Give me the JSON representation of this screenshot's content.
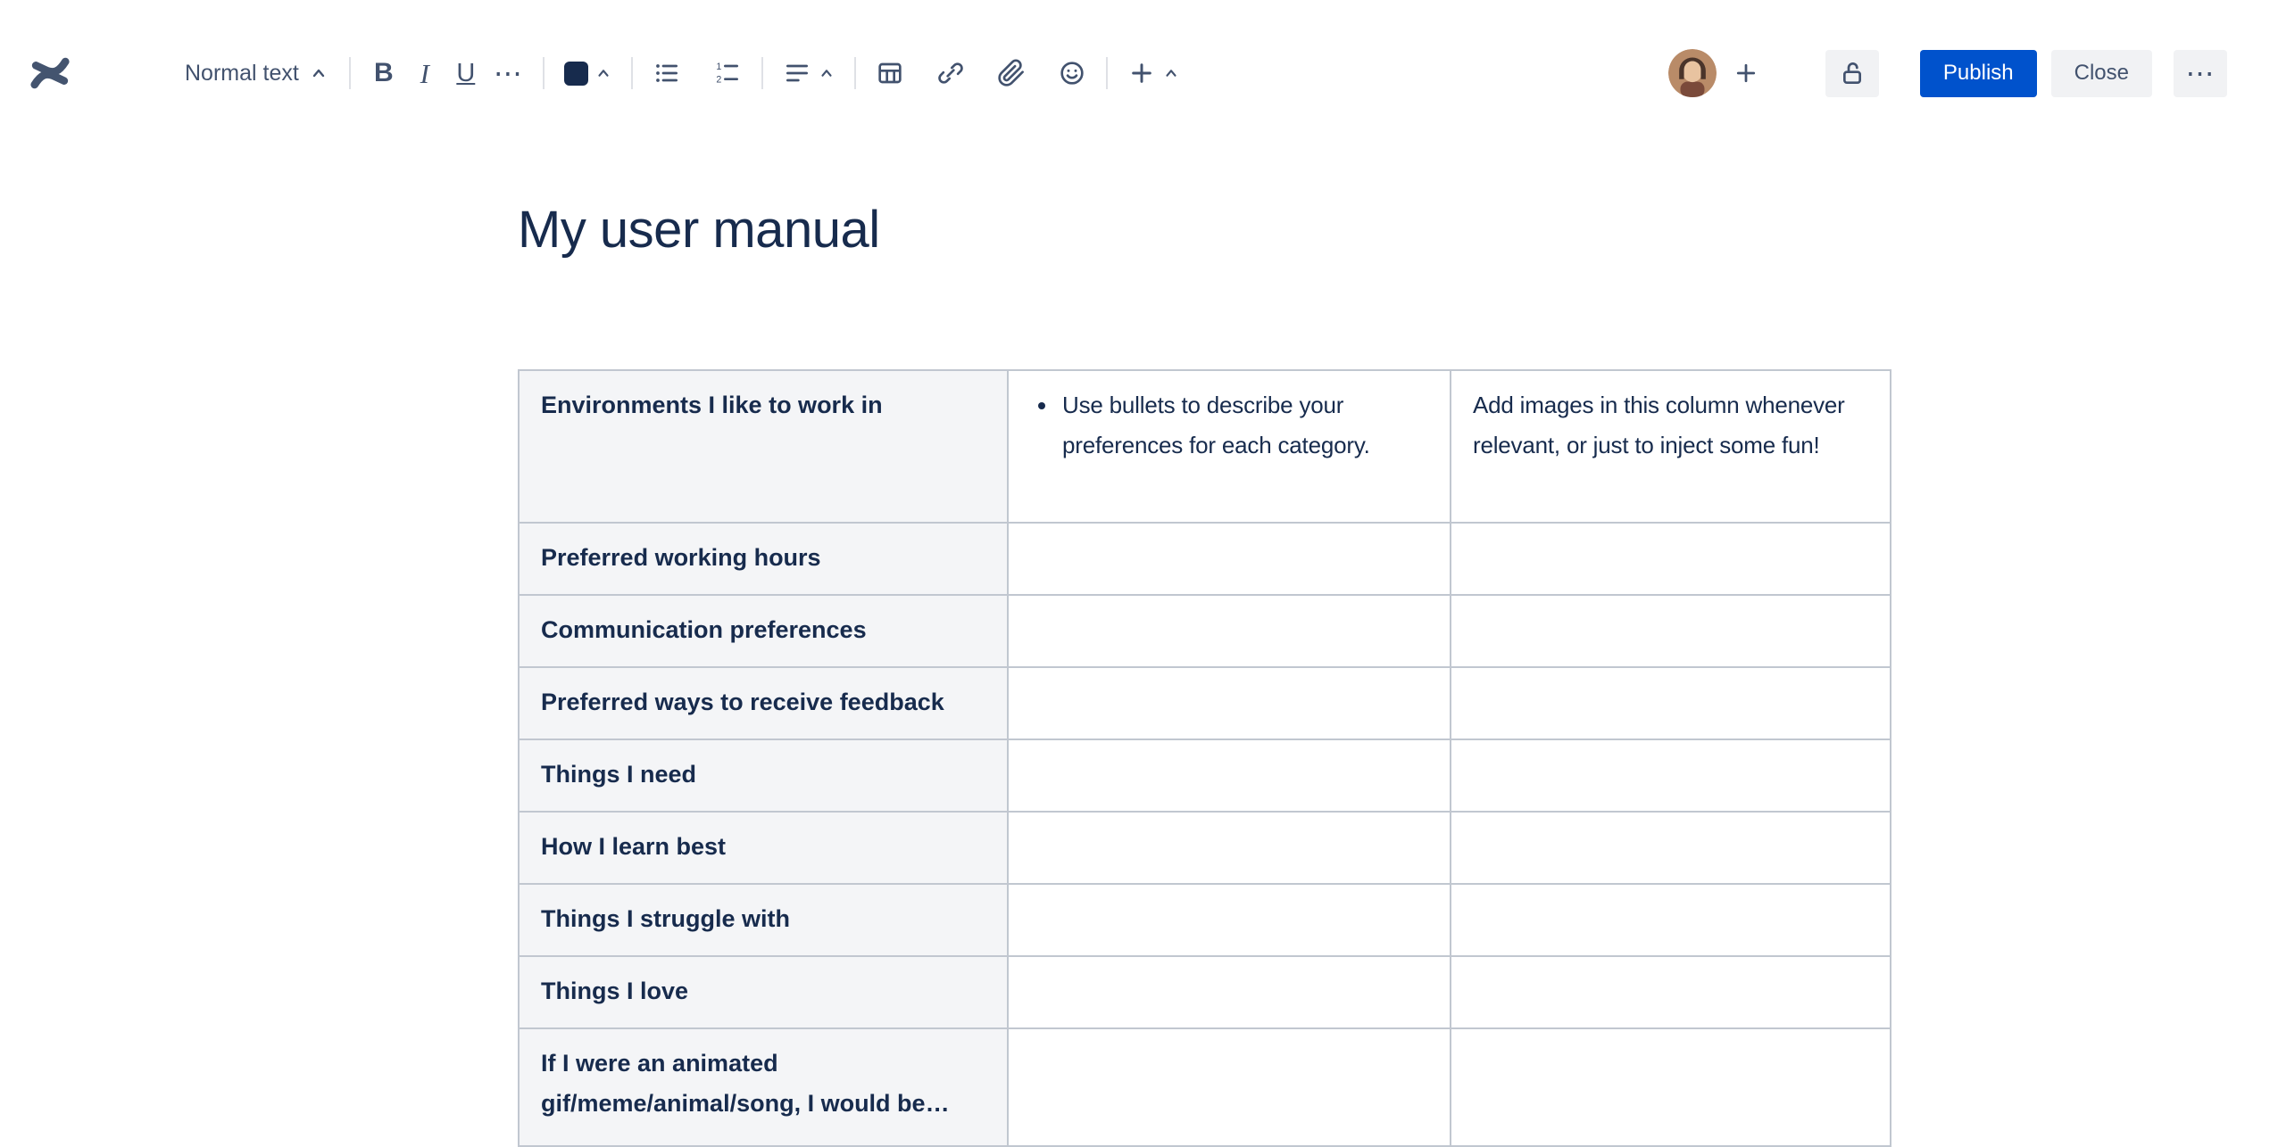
{
  "toolbar": {
    "text_style_label": "Normal text",
    "glyphs": {
      "bold": "B",
      "italic": "I",
      "underline": "U",
      "more": "⋯",
      "overflow": "⋯"
    },
    "publish_label": "Publish",
    "close_label": "Close"
  },
  "page": {
    "title": "My user manual"
  },
  "table": {
    "header_row": {
      "label": "Environments I like to work in",
      "bullet_item": "Use bullets to describe your preferences for each category.",
      "images_note": "Add images in this column whenever relevant, or just to inject some fun!"
    },
    "row_labels": [
      "Preferred working hours",
      "Communication preferences",
      "Preferred ways to receive feedback",
      "Things I need",
      "How I learn best",
      "Things I struggle with",
      "Things I love",
      "If I were an animated gif/meme/animal/song, I would be…"
    ]
  },
  "colors": {
    "publish_button": "#0052CC",
    "toolbar_icon": "#42526E",
    "cell_text": "#172B4D",
    "table_border": "#C1C7D0",
    "label_cell_background": "#F4F5F7",
    "neutral_button_background": "#F1F2F4"
  }
}
